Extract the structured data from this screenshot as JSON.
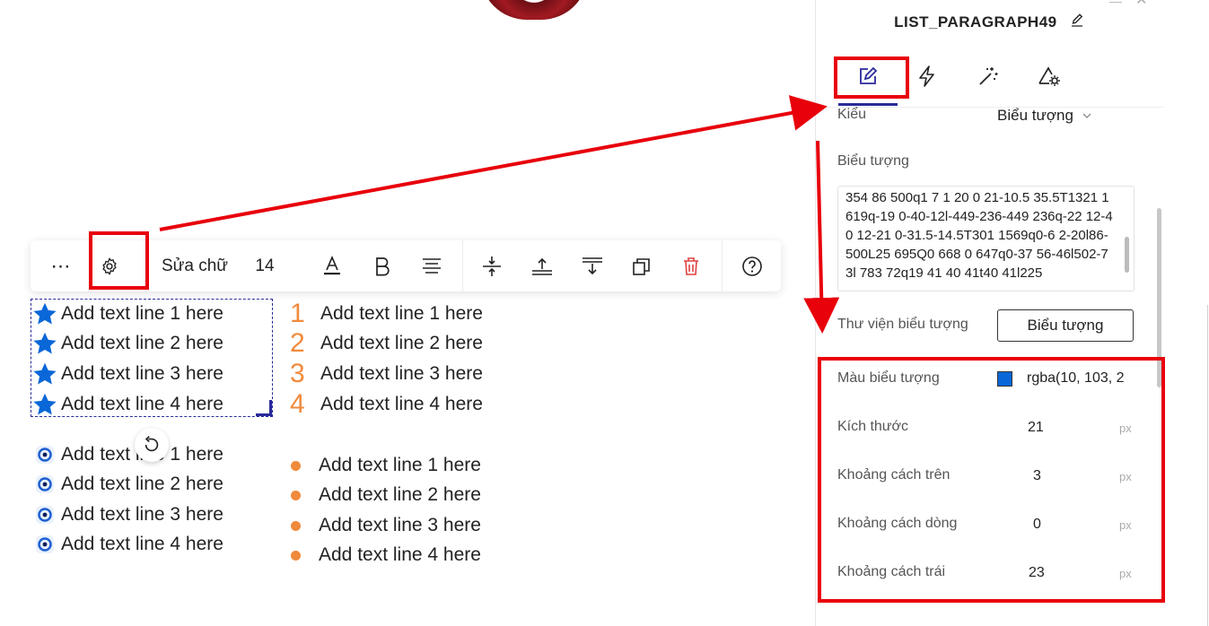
{
  "toolbar": {
    "more_label": "⋯",
    "edit_text_label": "Sửa chữ",
    "font_size": "14"
  },
  "lists": {
    "star_list": [
      "Add text line 1 here",
      "Add text line 2 here",
      "Add text line 3 here",
      "Add text line 4 here"
    ],
    "numbered_list": {
      "numbers": [
        "1",
        "2",
        "3",
        "4"
      ],
      "items": [
        "Add text line 1 here",
        "Add text line 2 here",
        "Add text line 3 here",
        "Add text line 4 here"
      ]
    },
    "icon_list": [
      "Add text line 1 here",
      "Add text line 2 here",
      "Add text line 3 here",
      "Add text line 4 here"
    ],
    "dot_list": [
      "Add text line 1 here",
      "Add text line 2 here",
      "Add text line 3 here",
      "Add text line 4 here"
    ]
  },
  "panel": {
    "title": "LIST_PARAGRAPH49",
    "style_label": "Kiểu",
    "style_value": "Biểu tượng",
    "icon_label": "Biểu tượng",
    "icon_code": "354 86 500q1 7 1 20 0 21-10.5 35.5T1321 1619q-19 0-40-12l-449-236-449 236q-22 12-40 12-21 0-31.5-14.5T301 1569q0-6 2-20l86-500L25 695Q0 668 0 647q0-37 56-46l502-73l 783 72q19 41 40 41t40 41l225",
    "library_label": "Thư viện biểu tượng",
    "library_button": "Biểu tượng",
    "color_label": "Màu biểu tượng",
    "color_value": "rgba(10, 103, 2",
    "size_label": "Kích thước",
    "size_value": "21",
    "top_spacing_label": "Khoảng cách trên",
    "top_spacing_value": "3",
    "line_spacing_label": "Khoảng cách dòng",
    "line_spacing_value": "0",
    "left_spacing_label": "Khoảng cách trái",
    "left_spacing_value": "23",
    "unit": "px"
  },
  "colors": {
    "accent": "#2a2a9a",
    "highlight": "#e8000b",
    "icon_color": "#0a67d8",
    "orange": "#f08a3c"
  }
}
